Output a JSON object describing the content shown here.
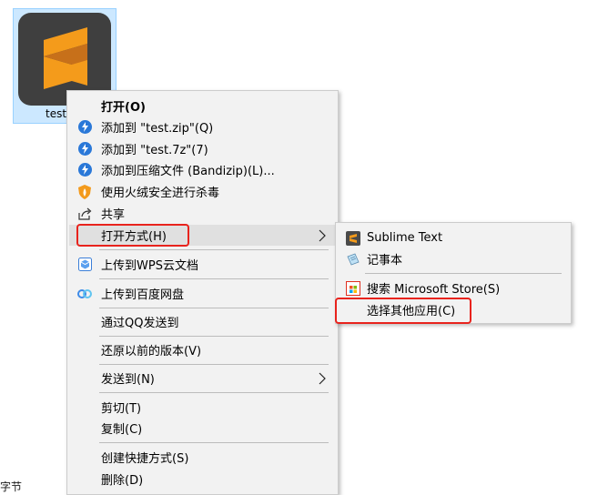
{
  "desktop": {
    "file_name": "test",
    "bottom_fragment": "字节"
  },
  "context_menu": {
    "items": [
      {
        "label": "打开(O)",
        "icon": "none",
        "bold": true
      },
      {
        "label": "添加到 \"test.zip\"(Q)",
        "icon": "bandizip-icon"
      },
      {
        "label": "添加到 \"test.7z\"(7)",
        "icon": "bandizip-icon"
      },
      {
        "label": "添加到压缩文件 (Bandizip)(L)...",
        "icon": "bandizip-icon"
      },
      {
        "label": "使用火绒安全进行杀毒",
        "icon": "huorong-shield-icon"
      },
      {
        "label": "共享",
        "icon": "share-icon"
      },
      {
        "label": "打开方式(H)",
        "icon": "none",
        "has_submenu": true
      },
      {
        "label": "上传到WPS云文档",
        "icon": "wps-cloud-icon"
      },
      {
        "label": "上传到百度网盘",
        "icon": "baidu-netdisk-icon"
      },
      {
        "label": "通过QQ发送到",
        "icon": "none"
      },
      {
        "label": "还原以前的版本(V)",
        "icon": "none"
      },
      {
        "label": "发送到(N)",
        "icon": "none",
        "has_submenu": true
      },
      {
        "label": "剪切(T)",
        "icon": "none"
      },
      {
        "label": "复制(C)",
        "icon": "none"
      },
      {
        "label": "创建快捷方式(S)",
        "icon": "none"
      },
      {
        "label": "删除(D)",
        "icon": "none"
      }
    ]
  },
  "open_with_submenu": {
    "items": [
      {
        "label": "Sublime Text",
        "icon": "sublime-text-icon"
      },
      {
        "label": "记事本",
        "icon": "notepad-icon"
      },
      {
        "label": "搜索 Microsoft Store(S)",
        "icon": "microsoft-store-icon"
      },
      {
        "label": "选择其他应用(C)",
        "icon": "none"
      }
    ]
  },
  "colors": {
    "highlight_box": "#e8231d",
    "menu_background": "#f2f2f2",
    "selection_tile": "#cce8ff",
    "sublime_orange": "#f49b1b",
    "bandizip_blue": "#2a78d8"
  }
}
